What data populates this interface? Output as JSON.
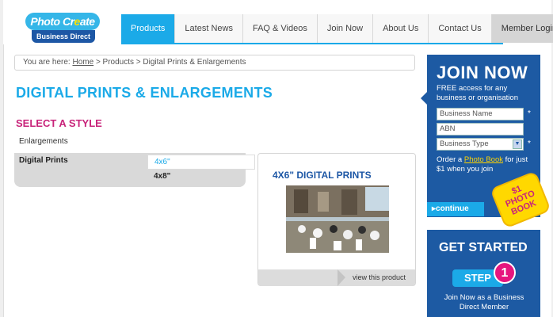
{
  "logo": {
    "line1_a": "Photo Cr",
    "line1_b": "e",
    "line1_c": "ate",
    "line2": "Business Direct"
  },
  "nav": {
    "items": [
      "Products",
      "Latest News",
      "FAQ & Videos",
      "Join Now",
      "About Us",
      "Contact Us",
      "Member Login"
    ],
    "active": "Products"
  },
  "breadcrumb": {
    "prefix": "You are here:",
    "home": "Home",
    "rest": "> Products > Digital Prints & Enlargements"
  },
  "page_title": "DIGITAL PRINTS & ENLARGEMENTS",
  "section_title": "SELECT A STYLE",
  "styles": {
    "enlargements": "Enlargements",
    "digital_prints": "Digital Prints",
    "options": [
      "4x6\"",
      "4x8\""
    ]
  },
  "product": {
    "title": "4X6\" DIGITAL PRINTS",
    "link": "view this product"
  },
  "join": {
    "title": "JOIN NOW",
    "subtitle": "FREE access for any business or organisation",
    "business_name_placeholder": "Business Name",
    "abn_placeholder": "ABN",
    "business_type": "Business Type",
    "required_mark": "*",
    "order_pre": "Order a",
    "order_link": "Photo Book",
    "order_post": "for just $1 when you join",
    "continue": "continue",
    "badge": "$1 PHOTO BOOK"
  },
  "get_started": {
    "title": "GET STARTED",
    "step_label": "STEP",
    "step_number": "1",
    "text": "Join Now as a Business Direct Member"
  },
  "colors": {
    "brand_blue": "#1baae8",
    "dark_blue": "#1d5aa3",
    "magenta": "#c8247a"
  }
}
